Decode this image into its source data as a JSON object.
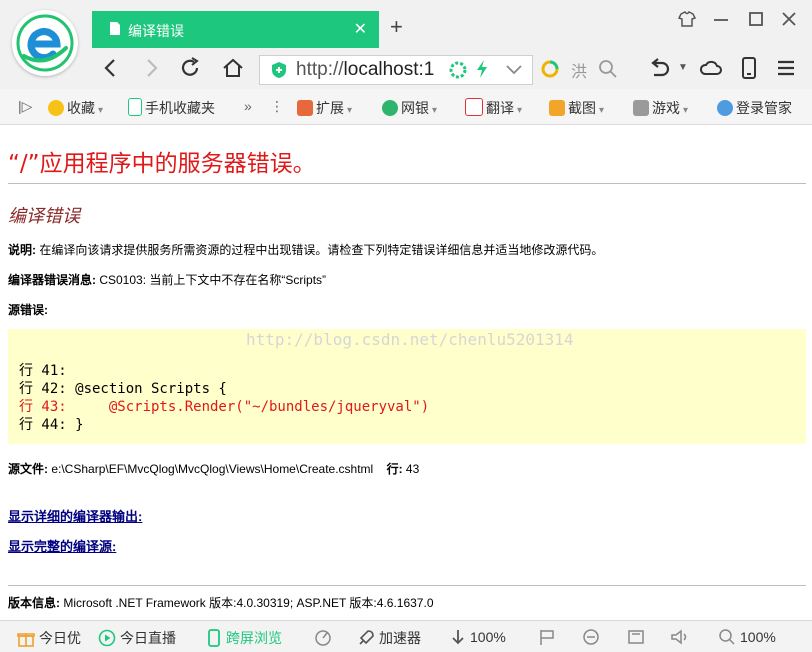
{
  "browser": {
    "tab_title": "编译错误",
    "url_prefix": "http://",
    "url_host": "localhost:1",
    "search_hint": "洪",
    "bookmarks": [
      "收藏",
      "手机收藏夹",
      "扩展",
      "网银",
      "翻译",
      "截图",
      "游戏",
      "登录管家"
    ],
    "accent": "#1ec77e"
  },
  "page": {
    "heading": "“/”应用程序中的服务器错误。",
    "subheading": "编译错误",
    "description_label": "说明:",
    "description": " 在编译向该请求提供服务所需资源的过程中出现错误。请检查下列特定错误详细信息并适当地修改源代码。",
    "compiler_msg_label": "编译器错误消息:",
    "compiler_msg": " CS0103: 当前上下文中不存在名称“Scripts”",
    "source_error_label": "源错误:",
    "watermark": "http://blog.csdn.net/chenlu5201314",
    "code_lines": [
      "行 41: ",
      "行 42: @section Scripts {",
      "行 43:     @Scripts.Render(\"~/bundles/jqueryval\")",
      "行 44: }"
    ],
    "source_file_label": "源文件:",
    "source_file": " e:\\CSharp\\EF\\MvcQlog\\MvcQlog\\Views\\Home\\Create.cshtml",
    "line_label": "行:",
    "line_number": " 43",
    "link_compiler_output": "显示详细的编译器输出:",
    "link_full_source": "显示完整的编译源:",
    "version_label": "版本信息:",
    "version": " Microsoft .NET Framework 版本:4.0.30319; ASP.NET 版本:4.6.1637.0",
    "error_color": "#e01818"
  },
  "statusbar": {
    "items": [
      "今日优",
      "今日直播",
      "跨屏浏览",
      "加速器"
    ],
    "download_zoom": "100%",
    "zoom": "100%"
  }
}
